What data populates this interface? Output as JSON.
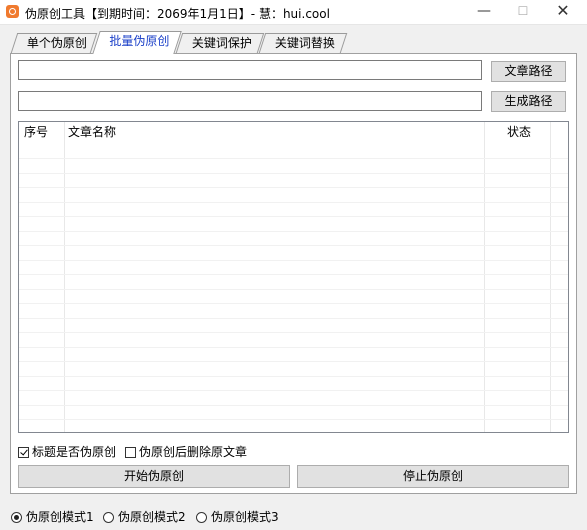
{
  "window": {
    "title": "伪原创工具【到期时间：2069年1月1日】- 慧：hui.cool",
    "minimize": "—",
    "maximize": "☐",
    "close": "✕"
  },
  "tabs": [
    {
      "label": "单个伪原创",
      "active": false
    },
    {
      "label": "批量伪原创",
      "active": true
    },
    {
      "label": "关键词保护",
      "active": false
    },
    {
      "label": "关键词替换",
      "active": false
    }
  ],
  "paths": {
    "article_path_value": "",
    "article_path_button": "文章路径",
    "output_path_value": "",
    "output_path_button": "生成路径"
  },
  "table": {
    "columns": [
      "序号",
      "文章名称",
      "状态"
    ],
    "rows": []
  },
  "options": {
    "title_rewrite_label": "标题是否伪原创",
    "title_rewrite_checked": true,
    "delete_original_label": "伪原创后删除原文章",
    "delete_original_checked": false
  },
  "actions": {
    "start_label": "开始伪原创",
    "stop_label": "停止伪原创"
  },
  "modes": [
    {
      "label": "伪原创模式1",
      "selected": true
    },
    {
      "label": "伪原创模式2",
      "selected": false
    },
    {
      "label": "伪原创模式3",
      "selected": false
    }
  ],
  "colors": {
    "active_tab_text": "#1a3fc8",
    "app_icon": "#f07a2e"
  }
}
